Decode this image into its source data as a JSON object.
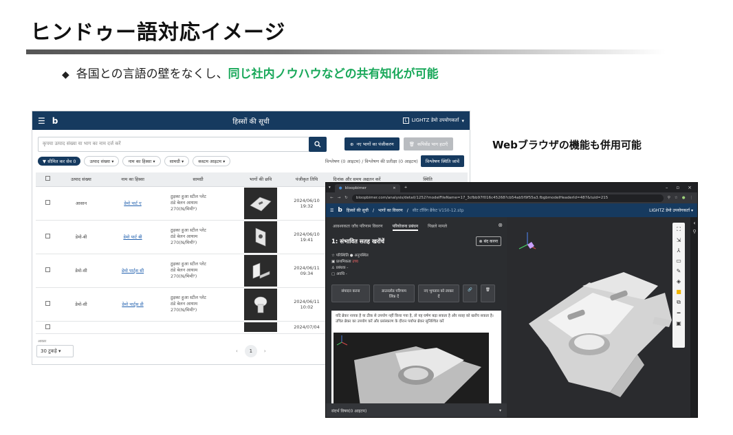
{
  "slide": {
    "title": "ヒンドゥー語対応イメージ",
    "bullet_prefix": "各国との言語の壁をなくし、",
    "bullet_highlight": "同じ社内ノウハウなどの共有知化が可能",
    "side_note": "Webブラウザの機能も併用可能"
  },
  "app1": {
    "menu_icon": "menu-icon",
    "logo": "b",
    "title": "हिस्सों की सूची",
    "brand": "LIGHTZ डेमो उपयोगकर्ता",
    "search_placeholder": "कृपया उत्पाद संख्या या भाग का नाम दर्ज करें",
    "register_button": "नए भागों का पंजीकरण",
    "delete_button": "कपिसेंड भाग हटाएँ",
    "filters": {
      "limited": "सीमित कर सेव",
      "limited_count": "0",
      "chips": [
        "उत्पाद संख्या",
        "नाम का हिस्सा",
        "सामग्री",
        "कस्टम आइटम"
      ],
      "status_text": "विश्लेषण (0 आइटम) / विश्लेषण की प्रतीक्षा (0 आइटम)",
      "status_button": "विश्लेषण स्थिति जांचें"
    },
    "columns": [
      "उत्पाद संख्या",
      "नाम का हिस्सा",
      "सामग्री",
      "भागों की छवि",
      "पंजीकृत तिथि",
      "दिनांक और समय अद्यतन करें",
      "स्थिति"
    ],
    "rows": [
      {
        "product": "आसान",
        "name": "डेमो पार्ट ए",
        "material": [
          "ठुड़का हुआ स्टील प्लेट",
          "ठंडे बेलन आयाम",
          "270(N/मिमी²)"
        ],
        "date": "2024/06/10",
        "time": "19:32"
      },
      {
        "product": "डेमो-बी",
        "name": "डेमो पार्ट बी",
        "material": [
          "ठुड़का हुआ स्टील प्लेट",
          "ठंडे बेलन आयाम",
          "270(N/मिमी²)"
        ],
        "date": "2024/06/10",
        "time": "19:41"
      },
      {
        "product": "डेमो-सी",
        "name": "डेमो पार्ट्स सी",
        "material": [
          "ठुड़का हुआ स्टील प्लेट",
          "ठंडे बेलन आयाम",
          "270(N/मिमी²)"
        ],
        "date": "2024/06/11",
        "time": "09:34"
      },
      {
        "product": "डेमो-सी",
        "name": "डेमो पार्ट्स डी",
        "material": [
          "ठुड़का हुआ स्टील प्लेट",
          "ठंडे बेलन आयाम",
          "270(N/मिमी²)"
        ],
        "date": "2024/06/11",
        "time": "10:02"
      },
      {
        "product": "",
        "name": "",
        "material": [
          "",
          "",
          ""
        ],
        "date": "2024/07/04",
        "time": ""
      }
    ],
    "page_size_label": "आकार",
    "page_size": "30 टुकड़े",
    "current_page": "1"
  },
  "app2": {
    "tab_title": "bloopbimer",
    "url": "bloopbimer.com/analysis/detail/1252?modelFileName=17_3cfbb97f016c45268?cb54ab5f9f55a3.fbgbmodelHeaderId=487&tuid=215",
    "breadcrumb": [
      "हिस्सों की सूची",
      "भागों का विवरण",
      "सीट टॉविंग ब्रैकेट V150-12.stp"
    ],
    "brand": "LIGHTZ डेमो उपयोगकर्ता",
    "panel_tabs": [
      "आवश्यकता जाँच परिणाम विवरण",
      "परियोजना प्रबंधन",
      "पिछले मामले"
    ],
    "issue_title": "1: संभावित सतह खरोंचें",
    "close_button": "बंद करना",
    "props": [
      {
        "label": "परिस्थिति",
        "value": "अनुपस्थित"
      },
      {
        "label": "प्राथमिकता",
        "value": "उच्च"
      },
      {
        "label": "प्रबंधक",
        "value": "-"
      },
      {
        "label": "अवधि",
        "value": "-"
      }
    ],
    "actions": [
      "संपादन करना",
      "डाउनलोड परिणाम लिंक दें",
      "नए भुगतान को लाकर दें"
    ],
    "description": "यदि ब्रेकर नायक है या ठीक से उपयोग नहीं किया गया है, तो यह घर्षण बढ़ा सकता है और सतह को खरोंच सकता है। उचित ब्रेकर का उपयोग करें और प्रसंस्करण के दौरान पर्याप्त ब्रेकर सुनिश्चित करें",
    "reference_section": "संदर्भ विषय(0 आइटम)",
    "toolbar_icons": [
      "fit-icon",
      "zoom-icon",
      "axis-icon",
      "measure-icon",
      "pen-icon",
      "cube-icon",
      "color-icon",
      "section-icon",
      "line-icon",
      "camera-icon"
    ]
  }
}
